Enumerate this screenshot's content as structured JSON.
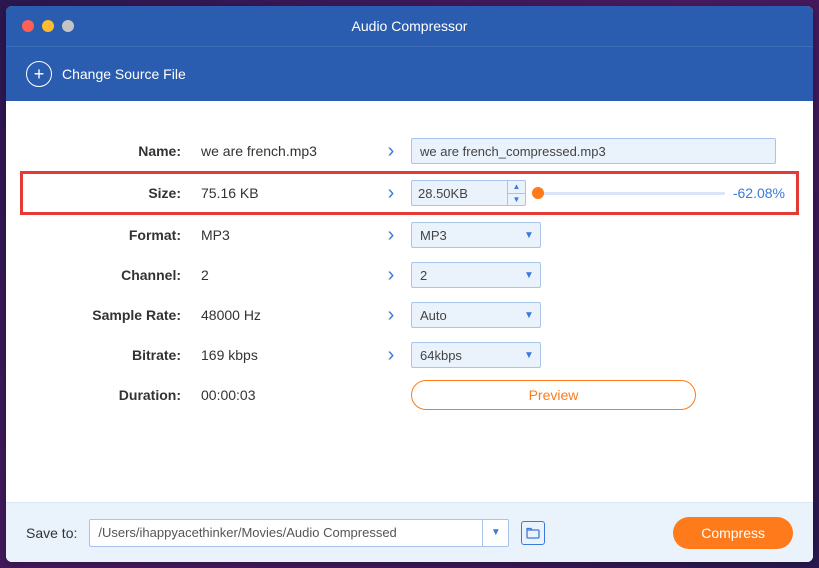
{
  "window": {
    "title": "Audio Compressor"
  },
  "subheader": {
    "change_source": "Change Source File"
  },
  "rows": {
    "name": {
      "label": "Name:",
      "src": "we are french.mp3",
      "target": "we are french_compressed.mp3"
    },
    "size": {
      "label": "Size:",
      "src": "75.16 KB",
      "target": "28.50KB",
      "pct": "-62.08%"
    },
    "format": {
      "label": "Format:",
      "src": "MP3",
      "target": "MP3"
    },
    "channel": {
      "label": "Channel:",
      "src": "2",
      "target": "2"
    },
    "sample_rate": {
      "label": "Sample Rate:",
      "src": "48000 Hz",
      "target": "Auto"
    },
    "bitrate": {
      "label": "Bitrate:",
      "src": "169 kbps",
      "target": "64kbps"
    },
    "duration": {
      "label": "Duration:",
      "src": "00:00:03"
    }
  },
  "buttons": {
    "preview": "Preview",
    "compress": "Compress"
  },
  "footer": {
    "label": "Save to:",
    "path": "/Users/ihappyacethinker/Movies/Audio Compressed"
  }
}
